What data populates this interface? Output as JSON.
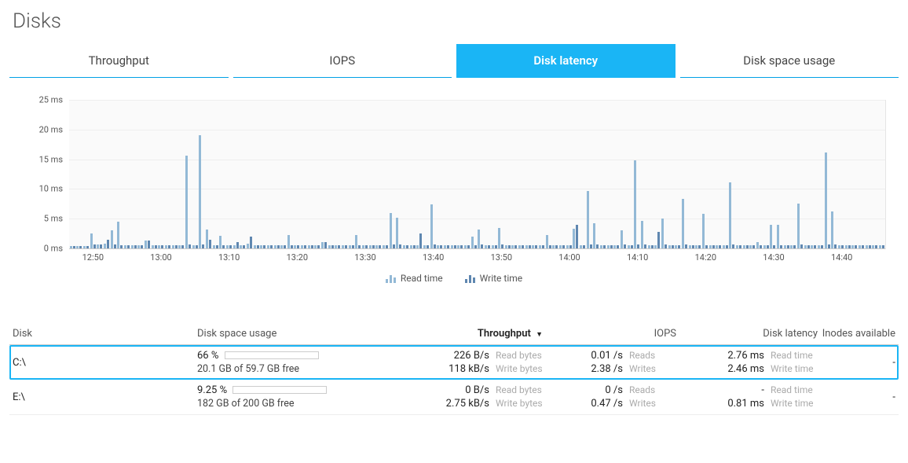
{
  "title": "Disks",
  "tabs": [
    {
      "id": "throughput",
      "label": "Throughput"
    },
    {
      "id": "iops",
      "label": "IOPS"
    },
    {
      "id": "latency",
      "label": "Disk latency",
      "active": true
    },
    {
      "id": "space",
      "label": "Disk space usage"
    }
  ],
  "chart_legend": {
    "read": "Read time",
    "write": "Write time"
  },
  "chart_data": {
    "type": "bar",
    "title": "",
    "xlabel": "",
    "ylabel": "",
    "ylim": [
      0,
      25
    ],
    "yticks": [
      0,
      5,
      10,
      15,
      20,
      25
    ],
    "yunit": "ms",
    "categories": [
      "12:47",
      "12:48",
      "12:49",
      "12:50",
      "12:51",
      "12:52",
      "12:53",
      "12:54",
      "12:55",
      "12:56",
      "12:57",
      "12:58",
      "12:59",
      "13:00",
      "13:01",
      "13:02",
      "13:03",
      "13:04",
      "13:05",
      "13:06",
      "13:07",
      "13:08",
      "13:09",
      "13:10",
      "13:11",
      "13:12",
      "13:13",
      "13:14",
      "13:15",
      "13:16",
      "13:17",
      "13:18",
      "13:19",
      "13:20",
      "13:21",
      "13:22",
      "13:23",
      "13:24",
      "13:25",
      "13:26",
      "13:27",
      "13:28",
      "13:29",
      "13:30",
      "13:31",
      "13:32",
      "13:33",
      "13:34",
      "13:35",
      "13:36",
      "13:37",
      "13:38",
      "13:39",
      "13:40",
      "13:41",
      "13:42",
      "13:43",
      "13:44",
      "13:45",
      "13:46",
      "13:47",
      "13:48",
      "13:49",
      "13:50",
      "13:51",
      "13:52",
      "13:53",
      "13:54",
      "13:55",
      "13:56",
      "13:57",
      "13:58",
      "13:59",
      "14:00",
      "14:01",
      "14:02",
      "14:03",
      "14:04",
      "14:05",
      "14:06",
      "14:07",
      "14:08",
      "14:09",
      "14:10",
      "14:11",
      "14:12",
      "14:13",
      "14:14",
      "14:15",
      "14:16",
      "14:17",
      "14:18",
      "14:19",
      "14:20",
      "14:21",
      "14:22",
      "14:23",
      "14:24",
      "14:25",
      "14:26",
      "14:27",
      "14:28",
      "14:29",
      "14:30",
      "14:31",
      "14:32",
      "14:33",
      "14:34",
      "14:35",
      "14:36",
      "14:37",
      "14:38",
      "14:39",
      "14:40",
      "14:41",
      "14:42",
      "14:43",
      "14:44",
      "14:45",
      "14:46"
    ],
    "xticks": [
      "12:50",
      "13:00",
      "13:10",
      "13:20",
      "13:30",
      "13:40",
      "13:50",
      "14:00",
      "14:10",
      "14:20",
      "14:30",
      "14:40"
    ],
    "series": [
      {
        "name": "Read time",
        "values": [
          0.4,
          0.4,
          0.4,
          2.5,
          0.6,
          0.8,
          3.0,
          4.5,
          0.5,
          0.5,
          0.5,
          1.3,
          0.5,
          0.5,
          0.5,
          0.5,
          0.5,
          15.6,
          0.5,
          19.0,
          3.2,
          0.5,
          2.1,
          0.5,
          0.5,
          0.5,
          0.8,
          0.5,
          0.5,
          0.5,
          0.5,
          0.5,
          2.3,
          0.5,
          0.5,
          0.5,
          0.5,
          1.0,
          0.5,
          0.5,
          0.5,
          0.5,
          2.3,
          0.5,
          0.5,
          0.5,
          0.5,
          6.0,
          5.1,
          0.5,
          0.5,
          0.5,
          0.5,
          7.4,
          0.5,
          0.5,
          0.5,
          0.5,
          0.5,
          2.0,
          3.2,
          0.5,
          0.5,
          3.5,
          0.5,
          0.5,
          0.5,
          0.5,
          0.5,
          0.5,
          2.3,
          0.5,
          0.5,
          0.5,
          3.3,
          0.5,
          9.6,
          4.3,
          0.5,
          0.5,
          0.5,
          3.0,
          0.5,
          14.8,
          4.6,
          0.5,
          0.5,
          5.0,
          0.5,
          0.5,
          8.4,
          0.5,
          0.5,
          5.8,
          0.5,
          0.5,
          0.5,
          11.1,
          0.5,
          0.5,
          0.5,
          1.0,
          0.5,
          4.0,
          4.0,
          0.5,
          0.5,
          7.6,
          0.5,
          0.5,
          0.5,
          16.1,
          6.2,
          0.5,
          0.5,
          0.5,
          0.5,
          0.5,
          0.5,
          0.5
        ]
      },
      {
        "name": "Write time",
        "values": [
          0.4,
          0.4,
          0.4,
          0.7,
          0.6,
          1.4,
          0.7,
          0.5,
          0.5,
          0.5,
          0.5,
          1.3,
          0.5,
          0.5,
          0.5,
          0.5,
          0.5,
          0.7,
          0.5,
          0.7,
          1.4,
          0.5,
          0.5,
          0.5,
          1.0,
          0.5,
          2.0,
          0.5,
          0.5,
          0.5,
          0.5,
          0.5,
          0.5,
          0.5,
          0.5,
          0.5,
          0.5,
          1.1,
          0.5,
          0.5,
          0.5,
          0.5,
          0.5,
          0.5,
          0.5,
          0.5,
          0.5,
          0.7,
          0.7,
          0.5,
          0.5,
          2.5,
          0.5,
          0.7,
          0.5,
          0.5,
          0.5,
          0.5,
          0.5,
          0.5,
          0.7,
          0.5,
          0.5,
          0.7,
          0.5,
          0.5,
          0.5,
          0.5,
          0.5,
          0.5,
          0.5,
          0.5,
          0.5,
          0.5,
          4.0,
          0.5,
          0.7,
          0.7,
          0.5,
          0.5,
          0.5,
          0.7,
          0.5,
          0.7,
          0.7,
          0.5,
          2.8,
          0.7,
          0.5,
          0.5,
          0.7,
          0.5,
          0.5,
          0.5,
          0.5,
          0.5,
          0.5,
          0.7,
          0.5,
          0.5,
          0.5,
          0.5,
          0.5,
          0.5,
          0.5,
          0.5,
          0.5,
          0.7,
          0.5,
          0.5,
          0.5,
          0.7,
          0.7,
          0.5,
          0.5,
          0.5,
          0.5,
          0.5,
          0.5,
          0.5
        ]
      }
    ]
  },
  "table": {
    "headers": {
      "disk": "Disk",
      "usage": "Disk space usage",
      "throughput": "Throughput",
      "iops": "IOPS",
      "latency": "Disk latency",
      "inodes": "Inodes available"
    },
    "sort": {
      "column": "throughput",
      "dir": "desc"
    },
    "rows": [
      {
        "id": "c",
        "name": "C:\\",
        "selected": true,
        "usage_pct": "66 %",
        "usage_fill": 66,
        "usage_text": "20.1 GB of 59.7 GB free",
        "throughput_read": "226 B/s",
        "throughput_write": "118 kB/s",
        "iops_read": "0.01 /s",
        "iops_write": "2.38 /s",
        "latency_read": "2.76 ms",
        "latency_write": "2.46 ms",
        "inodes": "-"
      },
      {
        "id": "e",
        "name": "E:\\",
        "selected": false,
        "usage_pct": "9.25 %",
        "usage_fill": 9.25,
        "usage_text": "182 GB of 200 GB free",
        "throughput_read": "0 B/s",
        "throughput_write": "2.75 kB/s",
        "iops_read": "0 /s",
        "iops_write": "0.47 /s",
        "latency_read": "-",
        "latency_write": "0.81 ms",
        "inodes": "-"
      }
    ],
    "sublabels": {
      "read_bytes": "Read bytes",
      "write_bytes": "Write bytes",
      "reads": "Reads",
      "writes": "Writes",
      "read_time": "Read time",
      "write_time": "Write time"
    }
  }
}
